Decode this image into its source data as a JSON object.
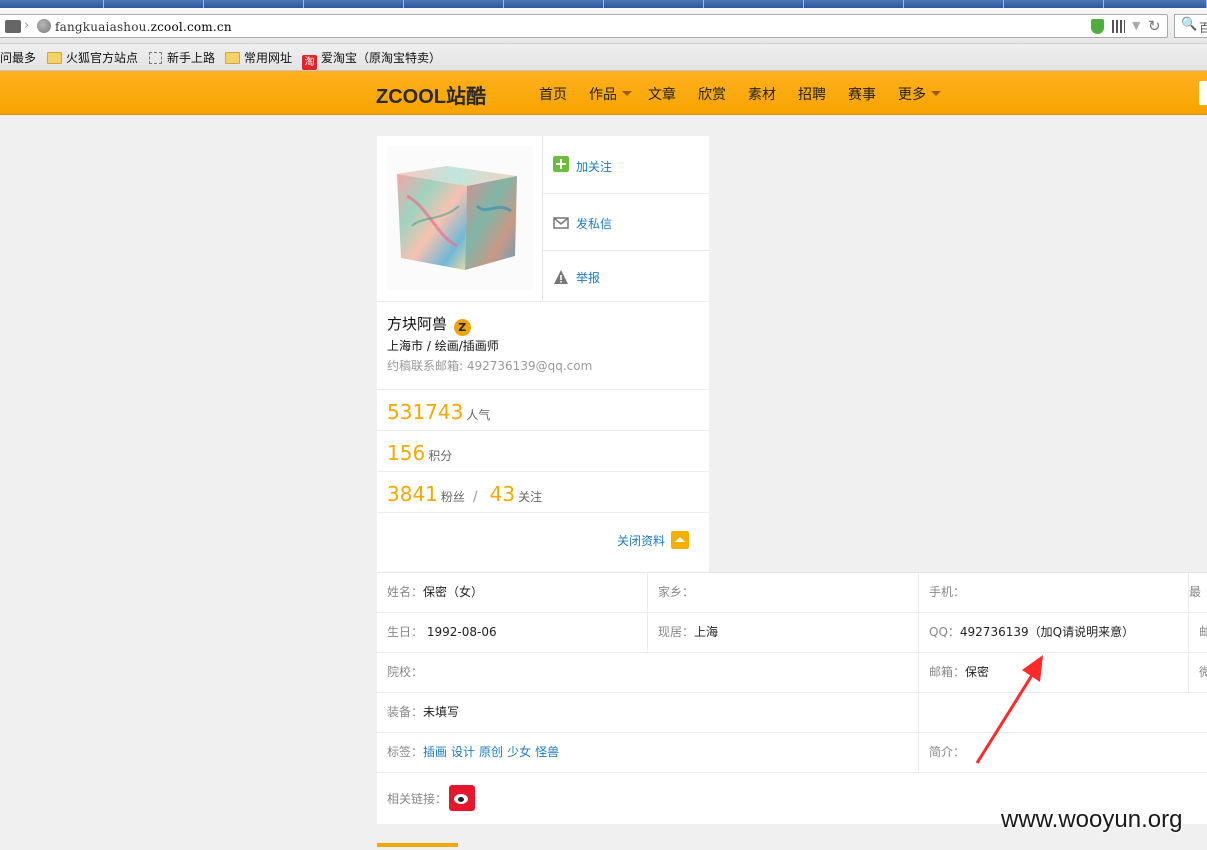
{
  "browser": {
    "url_prefix": "fangkuaiashou.",
    "url_domain": "zcool.com.cn",
    "search_partial": "百"
  },
  "bookmarks": [
    {
      "label": "访问最多",
      "icon": "none"
    },
    {
      "label": "火狐官方站点",
      "icon": "folder-icon"
    },
    {
      "label": "新手上路",
      "icon": "page-icon"
    },
    {
      "label": "常用网址",
      "icon": "folder-icon"
    },
    {
      "label": "爱淘宝（原淘宝特卖）",
      "icon": "taobao-icon"
    }
  ],
  "site": {
    "logo_text": "ZCOOL",
    "logo_cn": "站酷",
    "nav": [
      {
        "label": "首页",
        "dropdown": false
      },
      {
        "label": "作品",
        "dropdown": true
      },
      {
        "label": "文章",
        "dropdown": false
      },
      {
        "label": "欣赏",
        "dropdown": false
      },
      {
        "label": "素材",
        "dropdown": false
      },
      {
        "label": "招聘",
        "dropdown": false
      },
      {
        "label": "赛事",
        "dropdown": false
      },
      {
        "label": "更多",
        "dropdown": true
      }
    ],
    "accent_color": "#f4a900"
  },
  "profile": {
    "actions": {
      "follow": "加关注",
      "message": "发私信",
      "report": "举报"
    },
    "name": "方块阿兽",
    "badge": "Z",
    "location": "上海市",
    "loc_sep": "/",
    "profession": "绘画/插画师",
    "contact_label": "约稿联系邮箱:",
    "contact_email": "492736139@qq.com",
    "popularity": {
      "value": "531743",
      "label": "人气"
    },
    "points": {
      "value": "156",
      "label": "积分"
    },
    "fans": {
      "value": "3841",
      "label": "粉丝"
    },
    "stat_sep": "/",
    "following": {
      "value": "43",
      "label": "关注"
    },
    "close_profile": "关闭资料"
  },
  "details": {
    "name_label": "姓名：",
    "name_value": "保密（女）",
    "hometown_label": "家乡：",
    "phone_label": "手机：",
    "last_col_1": "最",
    "birthday_label": "生日：",
    "birthday_value": "1992-08-06",
    "residence_label": "现居：",
    "residence_value": "上海",
    "qq_label": "QQ：",
    "qq_value": "492736139（加Q请说明来意）",
    "last_col_2": "邮",
    "school_label": "院校：",
    "email_label": "邮箱：",
    "email_value": "保密",
    "last_col_3": "微",
    "equipment_label": "装备：",
    "equipment_value": "未填写",
    "tags_label": "标签：",
    "tags": [
      "插画",
      "设计",
      "原创",
      "少女",
      "怪兽"
    ],
    "intro_label": "简介：",
    "links_label": "相关链接："
  },
  "watermark": "www.wooyun.org"
}
